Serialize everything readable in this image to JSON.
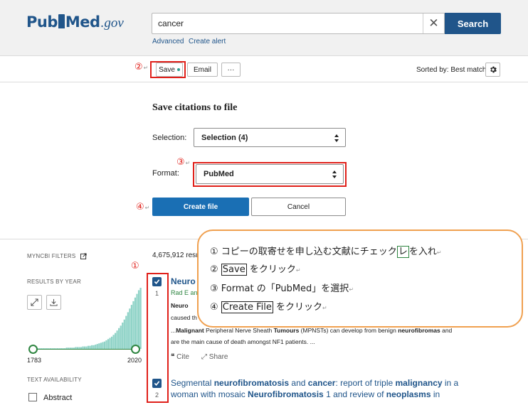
{
  "header": {
    "logo_main_left": "Pub",
    "logo_main_right": "Med",
    "logo_gov": ".gov",
    "search_value": "cancer",
    "search_button": "Search",
    "links": [
      "Advanced",
      "Create alert"
    ]
  },
  "toolbar": {
    "save_label": "Save",
    "email_label": "Email",
    "more_label": "···",
    "sorted_by": "Sorted by: Best match"
  },
  "save_panel": {
    "title": "Save citations to file",
    "selection_label": "Selection:",
    "selection_value": "Selection (4)",
    "format_label": "Format:",
    "format_value": "PubMed",
    "create_file": "Create file",
    "cancel": "Cancel"
  },
  "markers": {
    "m1": "①",
    "m2": "②",
    "m3": "③",
    "m4": "④"
  },
  "sidebar": {
    "myncbi_filters": "MYNCBI FILTERS",
    "results_by_year": "RESULTS BY YEAR",
    "year_start": "1783",
    "year_end": "2020",
    "text_availability": "TEXT AVAILABILITY",
    "abstract": "Abstract"
  },
  "results": {
    "count": "4,675,912 resu",
    "r1": {
      "num": "1",
      "title": "Neuro",
      "authors": "Rad E an",
      "snip1": "Neuro",
      "snip2": "caused th",
      "snip3_pre": "...",
      "snip3_b1": "Malignant",
      "snip3_mid": " Peripheral Nerve Sheath ",
      "snip3_b2": "Tumours",
      "snip3_post": " (MPNSTs) can develop from benign ",
      "snip3_b3": "neurofibromas",
      "snip3_end": " and",
      "snip4": "are the main cause of death amongst NF1 patients. ...",
      "cite": "Cite",
      "share": "Share"
    },
    "r2": {
      "num": "2",
      "t1": "Segmental ",
      "t2": "neurofibromatosis",
      "t3": " and ",
      "t4": "cancer",
      "t5": ": report of triple ",
      "t6": "malignancy",
      "t7": " in a woman with mosaic ",
      "t8": "Neurofibromatosis",
      "t9": " 1 and review of ",
      "t10": "neoplasms",
      "t11": " in"
    }
  },
  "callout": {
    "l1_num": "①",
    "l1_text": "コピーの取寄せを申し込む文献にチェック",
    "l1_box": "レ",
    "l1_end": "を入れ",
    "l2_num": "②",
    "l2_box": "Save",
    "l2_end": "をクリック",
    "l3_num": "③",
    "l3_text": "Format の「PubMed」を選択",
    "l4_num": "④",
    "l4_box": "Create File",
    "l4_end": "をクリック",
    "para_mark": "↵"
  },
  "histogram": [
    1,
    1,
    1,
    1,
    1,
    1,
    1,
    1,
    1,
    1,
    1,
    1,
    1,
    1,
    1,
    1,
    1,
    1,
    2,
    2,
    2,
    2,
    2,
    3,
    3,
    3,
    3,
    4,
    4,
    4,
    5,
    5,
    6,
    6,
    7,
    8,
    9,
    10,
    11,
    12,
    14,
    16,
    18,
    20,
    23,
    26,
    30,
    34,
    38,
    43,
    48,
    54,
    60,
    66,
    72,
    78,
    84,
    90,
    96,
    100
  ],
  "colors": {
    "brand": "#20558a",
    "accent_red": "#e0201a",
    "callout_border": "#f0a04f",
    "histogram": "#8fd3c7"
  }
}
